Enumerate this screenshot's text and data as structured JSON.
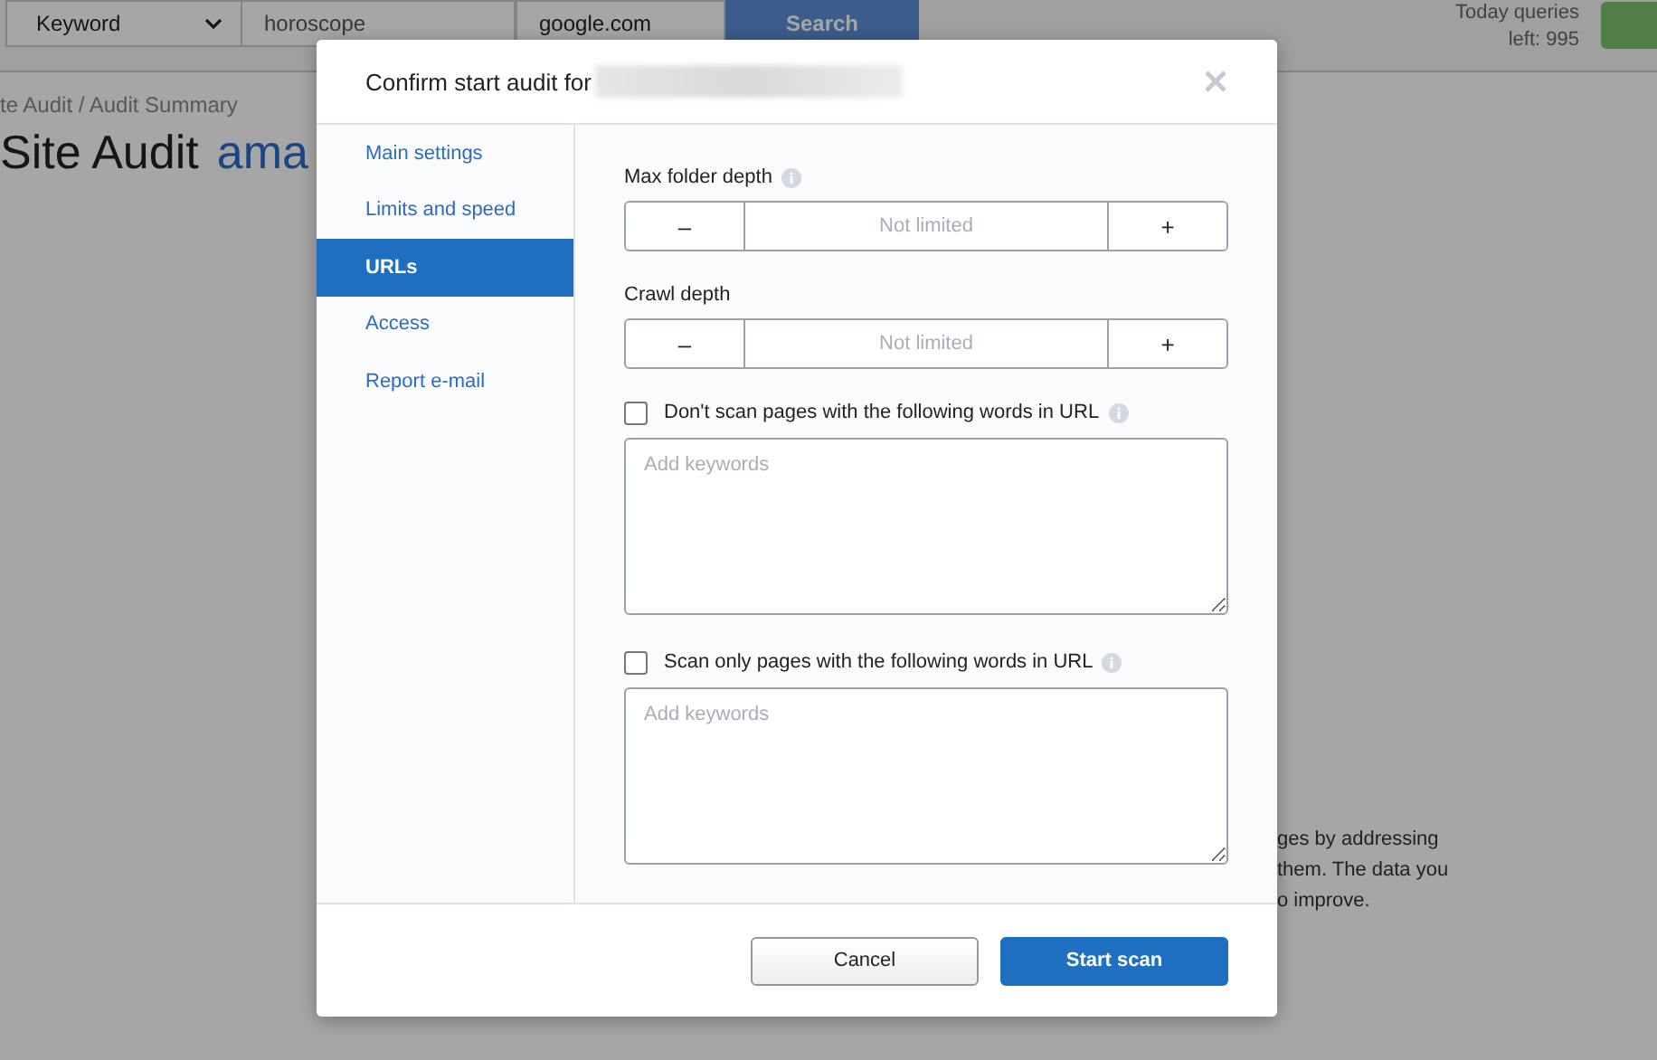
{
  "background_page": {
    "search_bar": {
      "type_dropdown": "Keyword",
      "query": "horoscope",
      "engine_dropdown": "google.com",
      "search_button": "Search"
    },
    "queries_info": [
      "Today queries",
      "left: 995"
    ],
    "breadcrumb": "te Audit / Audit Summary",
    "title": "Site Audit",
    "title_domain": "ama",
    "description_lines": [
      "ges by addressing",
      "them. The data you",
      "o improve."
    ]
  },
  "dialog": {
    "title": "Confirm start audit for",
    "nav": [
      {
        "label": "Main settings",
        "selected": false
      },
      {
        "label": "Limits and speed",
        "selected": false
      },
      {
        "label": "URLs",
        "selected": true
      },
      {
        "label": "Access",
        "selected": false
      },
      {
        "label": "Report e-mail",
        "selected": false
      }
    ],
    "steppers": [
      {
        "label": "Max folder depth",
        "info": true,
        "value": "Not limited",
        "minus": "–",
        "plus": "+"
      },
      {
        "label": "Crawl depth",
        "info": false,
        "value": "Not limited",
        "minus": "–",
        "plus": "+"
      }
    ],
    "keyword_filters": [
      {
        "label": "Don't scan pages with the following words in URL",
        "checked": false,
        "placeholder": "Add keywords"
      },
      {
        "label": "Scan only pages with the following words in URL",
        "checked": false,
        "placeholder": "Add keywords"
      }
    ],
    "buttons": [
      {
        "label": "Cancel",
        "kind": "secondary"
      },
      {
        "label": "Start scan",
        "kind": "primary"
      }
    ]
  }
}
